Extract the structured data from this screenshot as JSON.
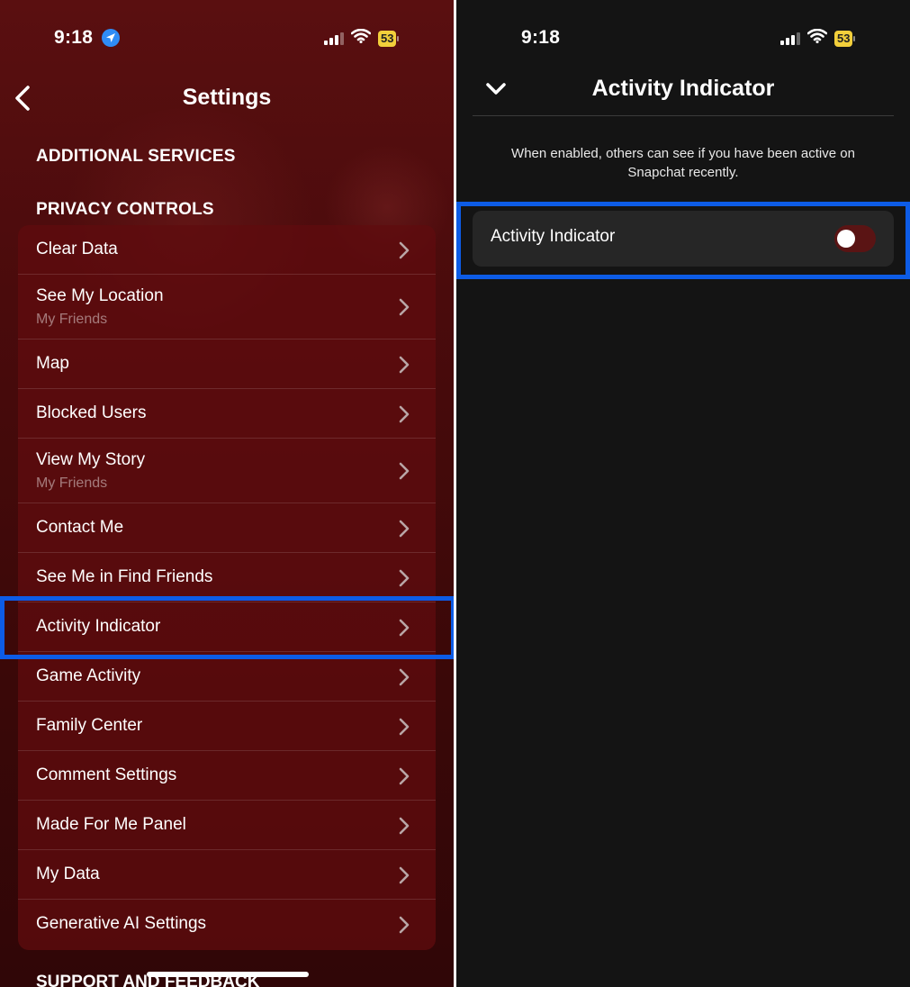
{
  "left": {
    "status": {
      "time": "9:18",
      "battery": "53"
    },
    "header": {
      "title": "Settings"
    },
    "sections": {
      "additional": "ADDITIONAL SERVICES",
      "privacy": "PRIVACY CONTROLS",
      "support": "SUPPORT AND FEEDBACK"
    },
    "items": [
      {
        "label": "Clear Data"
      },
      {
        "label": "See My Location",
        "sub": "My Friends"
      },
      {
        "label": "Map"
      },
      {
        "label": "Blocked Users"
      },
      {
        "label": "View My Story",
        "sub": "My Friends"
      },
      {
        "label": "Contact Me"
      },
      {
        "label": "See Me in Find Friends"
      },
      {
        "label": "Activity Indicator"
      },
      {
        "label": "Game Activity"
      },
      {
        "label": "Family Center"
      },
      {
        "label": "Comment Settings"
      },
      {
        "label": "Made For Me Panel"
      },
      {
        "label": "My Data"
      },
      {
        "label": "Generative AI Settings"
      }
    ]
  },
  "right": {
    "status": {
      "time": "9:18",
      "battery": "53"
    },
    "header": {
      "title": "Activity Indicator"
    },
    "description": "When enabled, others can see if you have been active on Snapchat recently.",
    "setting": {
      "label": "Activity Indicator",
      "enabled": false
    },
    "colors": {
      "toggle_off": "#5a1414",
      "highlight": "#0d5ce6"
    }
  }
}
